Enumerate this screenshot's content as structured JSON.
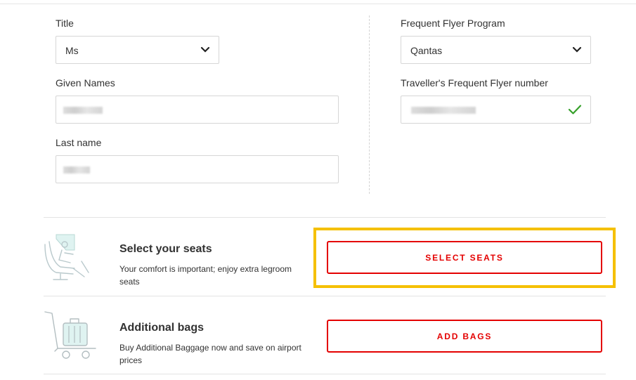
{
  "form": {
    "title": {
      "label": "Title",
      "value": "Ms"
    },
    "given_names": {
      "label": "Given Names"
    },
    "last_name": {
      "label": "Last name"
    },
    "ff_program": {
      "label": "Frequent Flyer Program",
      "value": "Qantas"
    },
    "ff_number": {
      "label": "Traveller's Frequent Flyer number",
      "validated": true
    }
  },
  "services": [
    {
      "title": "Select your seats",
      "description": "Your comfort is important; enjoy extra legroom seats",
      "button": "SELECT SEATS",
      "icon": "seat-icon",
      "highlighted": true
    },
    {
      "title": "Additional bags",
      "description": "Buy Additional Baggage now and save on airport prices",
      "button": "ADD BAGS",
      "icon": "luggage-trolley-icon"
    }
  ],
  "colors": {
    "accent": "#e40000",
    "highlight": "#f5c000",
    "check": "#36a02a"
  }
}
